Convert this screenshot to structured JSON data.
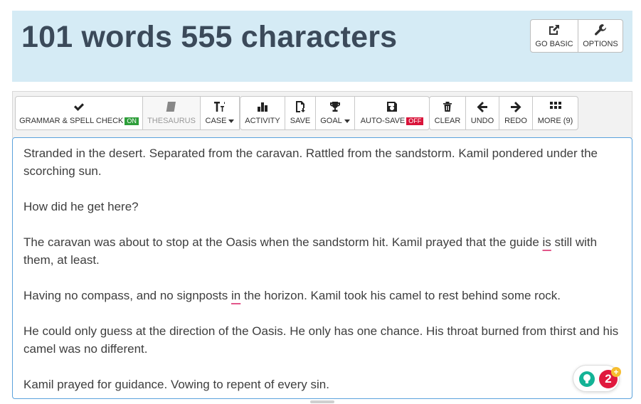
{
  "header": {
    "counter_text": "101 words 555 characters",
    "buttons": [
      {
        "label": "GO BASIC",
        "icon": "external-link-icon"
      },
      {
        "label": "OPTIONS",
        "icon": "wrench-icon"
      }
    ]
  },
  "toolbar": {
    "grammar": {
      "label": "GRAMMAR & SPELL CHECK",
      "state": "ON",
      "icon": "checkmark-icon"
    },
    "thesaurus": {
      "label": "THESAURUS",
      "icon": "book-icon"
    },
    "case": {
      "label": "CASE",
      "icon": "text-case-icon"
    },
    "activity": {
      "label": "ACTIVITY",
      "icon": "bar-chart-icon"
    },
    "save": {
      "label": "SAVE",
      "icon": "save-file-icon"
    },
    "goal": {
      "label": "GOAL",
      "icon": "trophy-icon"
    },
    "autosave": {
      "label": "AUTO-SAVE",
      "state": "OFF",
      "icon": "floppy-icon"
    },
    "clear": {
      "label": "CLEAR",
      "icon": "trash-icon"
    },
    "undo": {
      "label": "UNDO",
      "icon": "arrow-left-icon"
    },
    "redo": {
      "label": "REDO",
      "icon": "arrow-right-icon"
    },
    "more": {
      "label": "MORE (9)",
      "icon": "grid-icon"
    }
  },
  "editor": {
    "p1": "Stranded in the desert. Separated from the caravan. Rattled from the sandstorm. Kamil pondered under the scorching sun.",
    "p2": "How did he get here?",
    "p3_a": "The caravan was about to stop at the Oasis when the sandstorm hit. Kamil prayed that the guide ",
    "p3_err": "is",
    "p3_b": " still with them, at least.",
    "p4_a": "Having no compass, and no signposts ",
    "p4_err": "in",
    "p4_b": " the horizon. Kamil took his camel to rest behind some rock.",
    "p5": "He could only guess at the direction of the Oasis. He only has one chance. His throat burned from thirst and his camel was no different.",
    "p6": "Kamil prayed for guidance. Vowing to repent of every sin."
  },
  "grammarly": {
    "count": "2",
    "plus": "+"
  },
  "colors": {
    "header_bg": "#d5ebf5",
    "on": "#2e9e3a",
    "off": "#d9143a",
    "accent_border": "#5aa2dc",
    "grammarly_badge": "#e0193e"
  }
}
